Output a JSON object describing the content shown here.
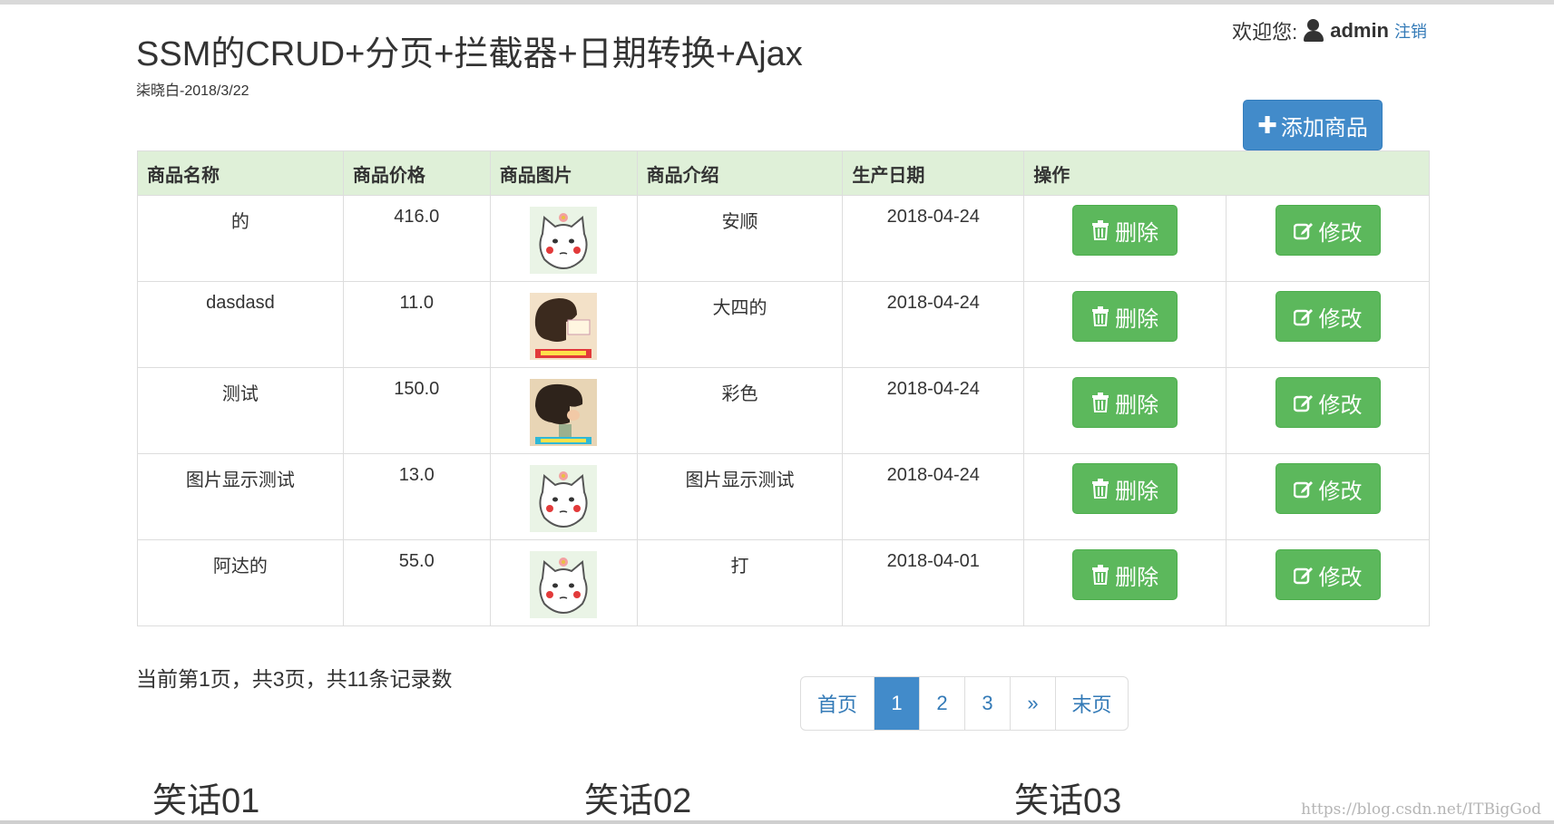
{
  "header": {
    "title": "SSM的CRUD+分页+拦截器+日期转换+Ajax",
    "subtitle": "柒晓白-2018/3/22"
  },
  "user": {
    "welcome_label": "欢迎您:",
    "username": "admin",
    "logout_label": "注销"
  },
  "toolbar": {
    "add_label": "添加商品"
  },
  "table": {
    "headers": [
      "商品名称",
      "商品价格",
      "商品图片",
      "商品介绍",
      "生产日期",
      "操作"
    ],
    "delete_label": "删除",
    "edit_label": "修改",
    "rows": [
      {
        "name": "的",
        "price": "416.0",
        "image": "cat-face",
        "intro": "安顺",
        "date": "2018-04-24"
      },
      {
        "name": "dasdasd",
        "price": "11.0",
        "image": "cartoon-head",
        "intro": "大四的",
        "date": "2018-04-24"
      },
      {
        "name": "测试",
        "price": "150.0",
        "image": "cartoon-head-2",
        "intro": "彩色",
        "date": "2018-04-24"
      },
      {
        "name": "图片显示测试",
        "price": "13.0",
        "image": "cat-face",
        "intro": "图片显示测试",
        "date": "2018-04-24"
      },
      {
        "name": "阿达的",
        "price": "55.0",
        "image": "cat-face",
        "intro": "打",
        "date": "2018-04-01"
      }
    ]
  },
  "pagination": {
    "info": "当前第1页，共3页，共11条记录数",
    "first": "首页",
    "pages": [
      "1",
      "2",
      "3"
    ],
    "current": "1",
    "next": "»",
    "last": "末页"
  },
  "jokes": [
    "笑话01",
    "笑话02",
    "笑话03"
  ],
  "watermark": "https://blog.csdn.net/ITBigGod",
  "colors": {
    "primary": "#428bca",
    "success": "#5cb85c",
    "header_bg": "#dff0d8",
    "link": "#337ab7"
  }
}
